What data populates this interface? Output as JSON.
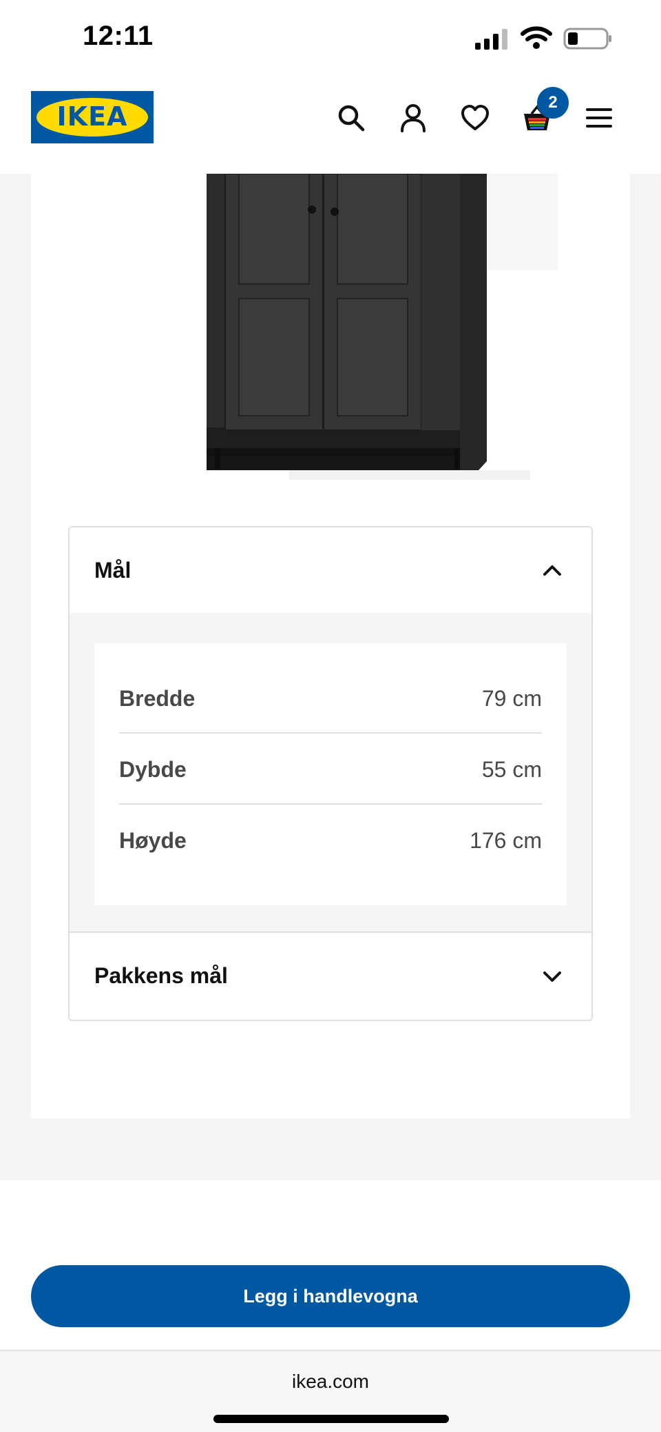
{
  "status_bar": {
    "time": "12:11"
  },
  "header": {
    "logo_text": "IKEA",
    "cart_count": "2"
  },
  "dimensions_section": {
    "title": "Mål",
    "rows": [
      {
        "label": "Bredde",
        "value": "79 cm"
      },
      {
        "label": "Dybde",
        "value": "55 cm"
      },
      {
        "label": "Høyde",
        "value": "176 cm"
      }
    ]
  },
  "package_section": {
    "title": "Pakkens mål"
  },
  "add_to_cart_label": "Legg i handlevogna",
  "browser": {
    "url": "ikea.com"
  },
  "colors": {
    "brand_blue": "#0058a3",
    "brand_yellow": "#ffdb00"
  },
  "icons": [
    "search-icon",
    "account-icon",
    "heart-icon",
    "cart-icon",
    "menu-icon",
    "chevron-up-icon",
    "chevron-down-icon"
  ]
}
